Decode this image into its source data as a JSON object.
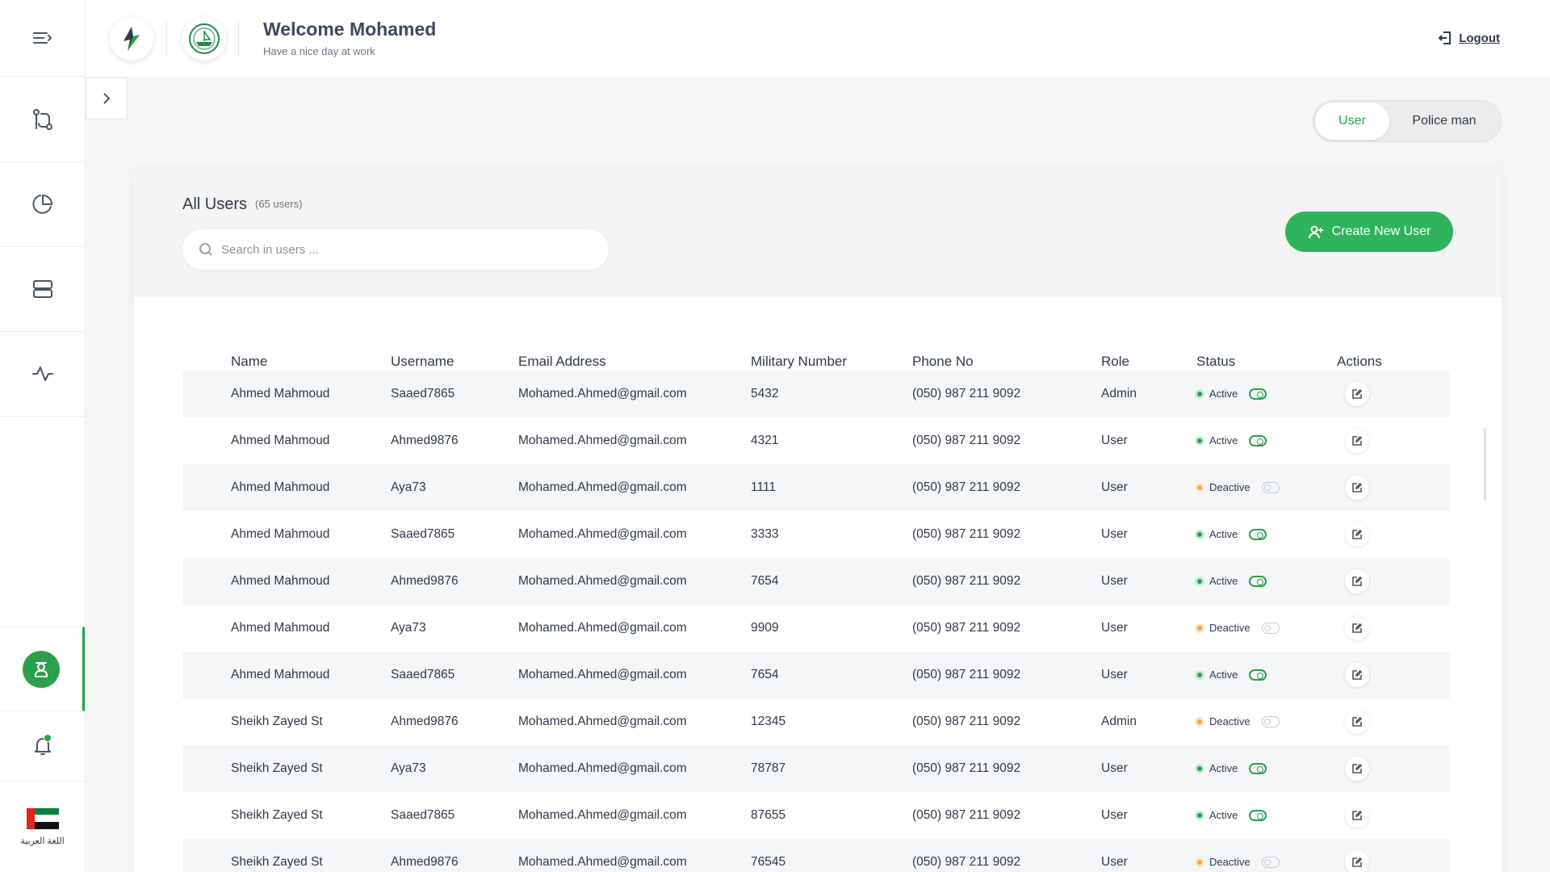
{
  "header": {
    "welcome": "Welcome Mohamed",
    "subtitle": "Have a nice day at work",
    "logout": "Logout"
  },
  "sidebar": {
    "items": [
      {
        "icon": "menu-expand-icon"
      },
      {
        "icon": "workflow-icon"
      },
      {
        "icon": "pie-chart-icon"
      },
      {
        "icon": "server-icon"
      },
      {
        "icon": "activity-icon"
      },
      {
        "icon": "user-profile-icon",
        "active": true
      },
      {
        "icon": "bell-icon"
      }
    ],
    "language": "اللغة العربية"
  },
  "toggle": {
    "user": "User",
    "policeman": "Police man",
    "selected": "User"
  },
  "users": {
    "title": "All Users",
    "count": "(65 users)",
    "search_placeholder": "Search in users ...",
    "create_button": "Create New User"
  },
  "table": {
    "headers": [
      "Name",
      "Username",
      "Email Address",
      "Military Number",
      "Phone No",
      "Role",
      "Status",
      "Actions"
    ],
    "rows": [
      {
        "name": "Ahmed Mahmoud",
        "username": "Saaed7865",
        "email": "Mohamed.Ahmed@gmail.com",
        "military": "5432",
        "phone": "(050) 987 211 9092",
        "role": "Admin",
        "status": "Active"
      },
      {
        "name": "Ahmed Mahmoud",
        "username": "Ahmed9876",
        "email": "Mohamed.Ahmed@gmail.com",
        "military": "4321",
        "phone": "(050) 987 211 9092",
        "role": "User",
        "status": "Active"
      },
      {
        "name": "Ahmed Mahmoud",
        "username": "Aya73",
        "email": "Mohamed.Ahmed@gmail.com",
        "military": "1111",
        "phone": "(050) 987 211 9092",
        "role": "User",
        "status": "Deactive"
      },
      {
        "name": "Ahmed Mahmoud",
        "username": "Saaed7865",
        "email": "Mohamed.Ahmed@gmail.com",
        "military": "3333",
        "phone": "(050) 987 211 9092",
        "role": "User",
        "status": "Active"
      },
      {
        "name": "Ahmed Mahmoud",
        "username": "Ahmed9876",
        "email": "Mohamed.Ahmed@gmail.com",
        "military": "7654",
        "phone": "(050) 987 211 9092",
        "role": "User",
        "status": "Active"
      },
      {
        "name": "Ahmed Mahmoud",
        "username": "Aya73",
        "email": "Mohamed.Ahmed@gmail.com",
        "military": "9909",
        "phone": "(050) 987 211 9092",
        "role": "User",
        "status": "Deactive"
      },
      {
        "name": "Ahmed Mahmoud",
        "username": "Saaed7865",
        "email": "Mohamed.Ahmed@gmail.com",
        "military": "7654",
        "phone": "(050) 987 211 9092",
        "role": "User",
        "status": "Active"
      },
      {
        "name": "Sheikh Zayed St",
        "username": "Ahmed9876",
        "email": "Mohamed.Ahmed@gmail.com",
        "military": "12345",
        "phone": "(050) 987 211 9092",
        "role": "Admin",
        "status": "Deactive"
      },
      {
        "name": "Sheikh Zayed St",
        "username": "Aya73",
        "email": "Mohamed.Ahmed@gmail.com",
        "military": "78787",
        "phone": "(050) 987 211 9092",
        "role": "User",
        "status": "Active"
      },
      {
        "name": "Sheikh Zayed St",
        "username": "Saaed7865",
        "email": "Mohamed.Ahmed@gmail.com",
        "military": "87655",
        "phone": "(050) 987 211 9092",
        "role": "User",
        "status": "Active"
      },
      {
        "name": "Sheikh Zayed St",
        "username": "Ahmed9876",
        "email": "Mohamed.Ahmed@gmail.com",
        "military": "76545",
        "phone": "(050) 987 211 9092",
        "role": "User",
        "status": "Deactive"
      }
    ]
  },
  "colors": {
    "accent": "#2aa04c",
    "button": "#2fb35a",
    "deactive": "#f2a93b"
  }
}
